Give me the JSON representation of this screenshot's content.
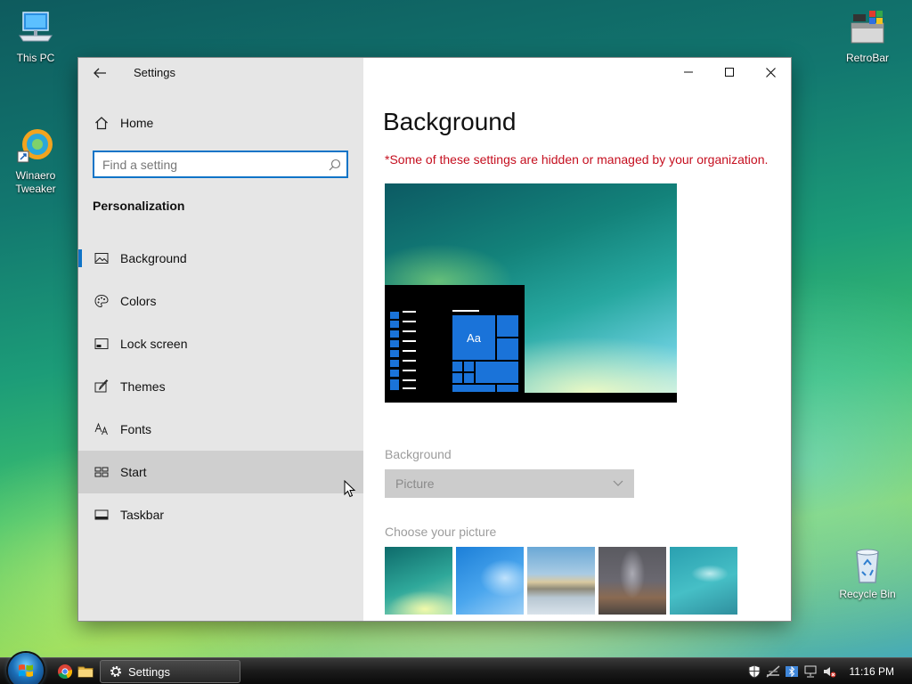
{
  "desktop": {
    "icons": [
      {
        "label": "This PC"
      },
      {
        "label": "Winaero\nTweaker"
      },
      {
        "label": "RetroBar"
      },
      {
        "label": "Recycle Bin"
      }
    ]
  },
  "window": {
    "title": "Settings",
    "back_icon": "back-arrow-icon",
    "caption": {
      "minimize": "minimize-icon",
      "maximize": "maximize-icon",
      "close": "close-icon"
    }
  },
  "nav": {
    "home_label": "Home",
    "search": {
      "placeholder": "Find a setting",
      "value": ""
    },
    "section_title": "Personalization",
    "items": [
      {
        "label": "Background",
        "icon": "picture-icon",
        "selected": true
      },
      {
        "label": "Colors",
        "icon": "palette-icon"
      },
      {
        "label": "Lock screen",
        "icon": "lock-screen-icon"
      },
      {
        "label": "Themes",
        "icon": "themes-brush-icon"
      },
      {
        "label": "Fonts",
        "icon": "fonts-icon"
      },
      {
        "label": "Start",
        "icon": "start-tiles-icon",
        "hovered": true
      },
      {
        "label": "Taskbar",
        "icon": "taskbar-icon"
      }
    ]
  },
  "main": {
    "title": "Background",
    "warning": "*Some of these settings are hidden or managed by your organization.",
    "preview": {
      "tile_label": "Aa"
    },
    "background_label": "Background",
    "background_value": "Picture",
    "choose_label": "Choose your picture",
    "thumbnail_count": 5
  },
  "taskbar": {
    "task_label": "Settings",
    "clock": "11:16 PM"
  },
  "colors": {
    "accent": "#0f74c7",
    "warning": "#c50f1f",
    "nav_bg": "#e6e6e6"
  }
}
